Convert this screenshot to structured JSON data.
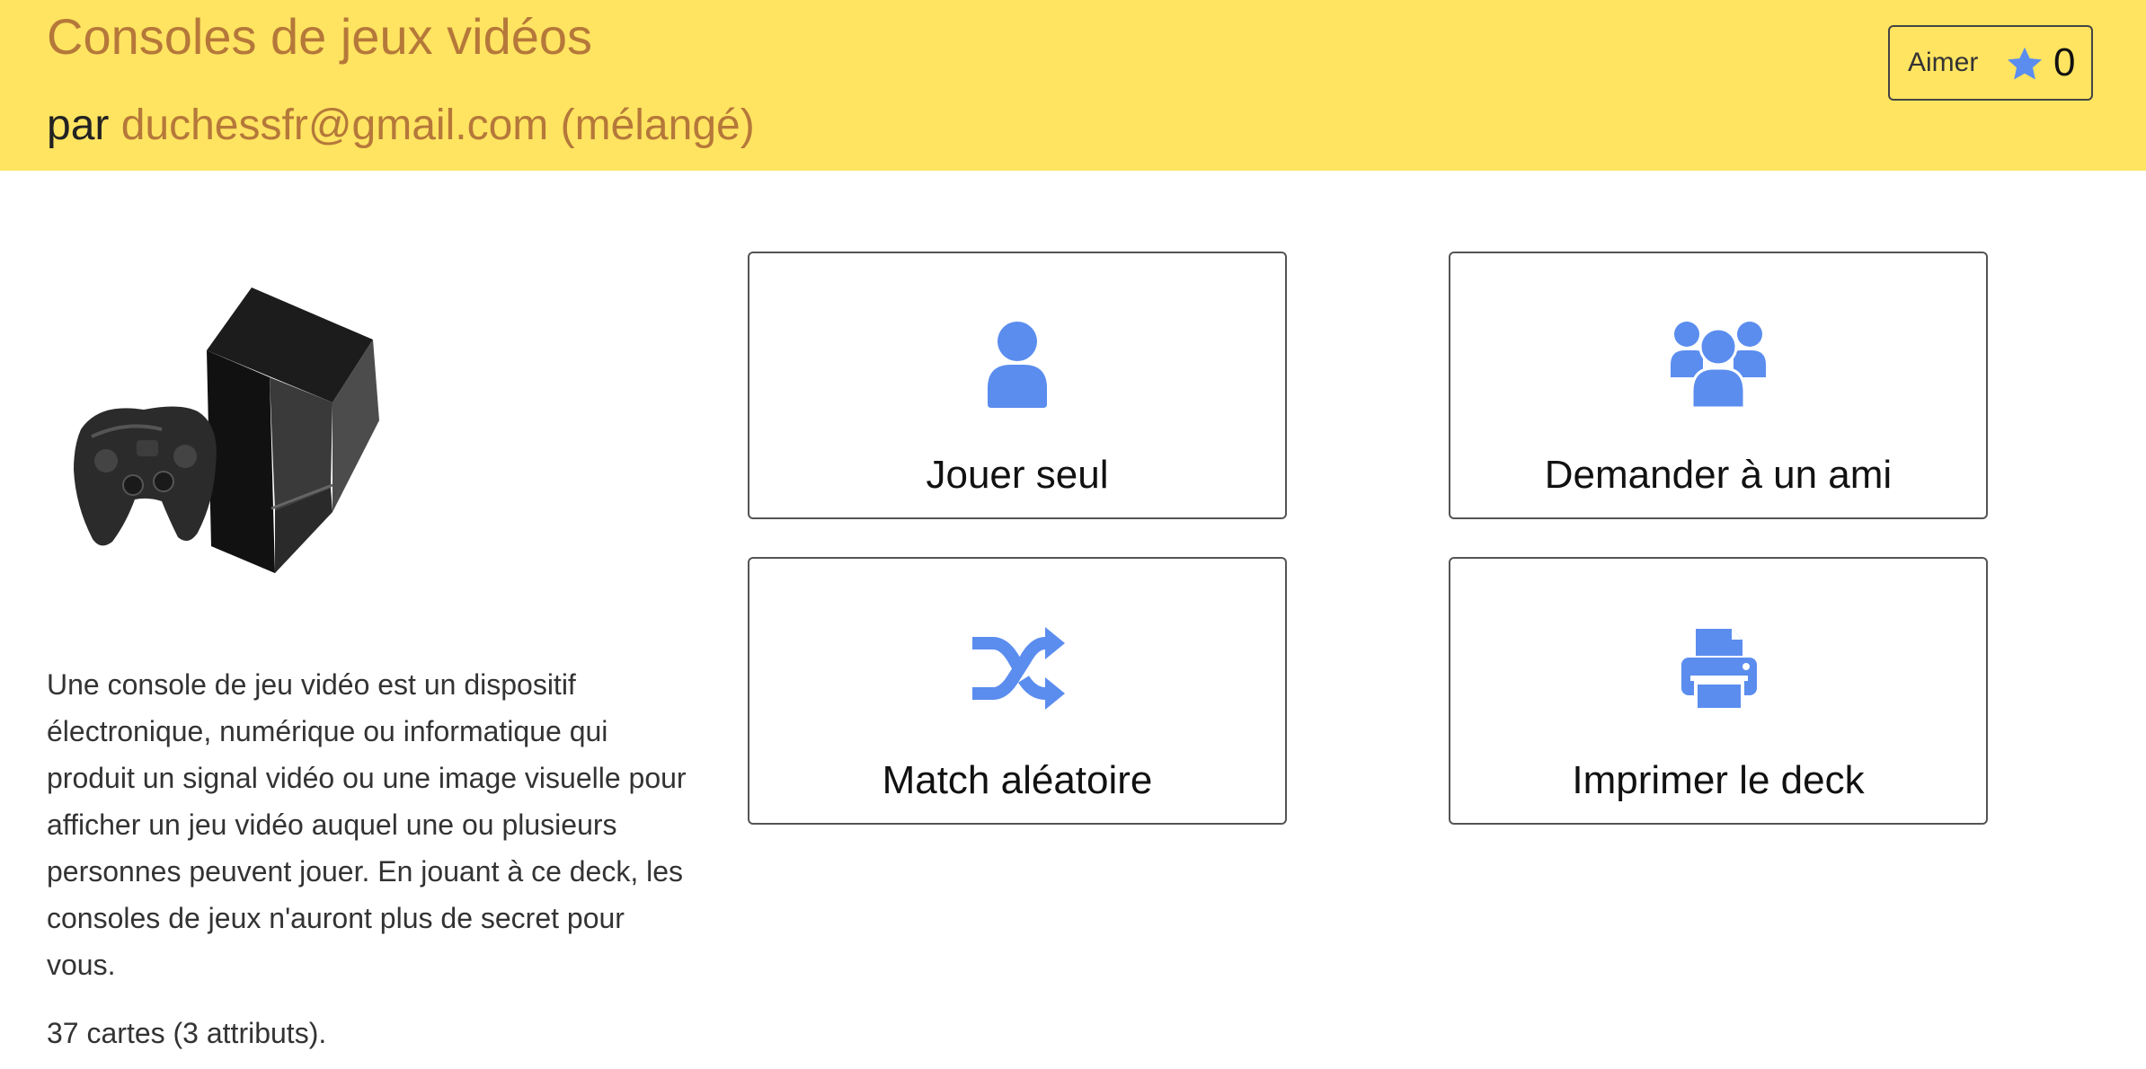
{
  "header": {
    "title": "Consoles de jeux vidéos",
    "by_prefix": "par",
    "author": "duchessfr@gmail.com (mélangé)",
    "background_color": "#ffe461",
    "title_color": "#b5783a"
  },
  "like": {
    "label": "Aimer",
    "icon": "star-icon",
    "count": "0",
    "icon_color": "#5b8def"
  },
  "deck": {
    "image": "game-console-image",
    "description": "Une console de jeu vidéo est un dispositif électronique, numérique ou informatique qui produit un signal vidéo ou une image visuelle pour afficher un jeu vidéo auquel une ou plusieurs personnes peuvent jouer. En jouant à ce deck, les consoles de jeux n'auront plus de secret pour vous.",
    "card_count": "37 cartes (3 attributs)."
  },
  "actions": [
    {
      "label": "Jouer seul",
      "icon": "user-icon"
    },
    {
      "label": "Demander à un ami",
      "icon": "users-icon"
    },
    {
      "label": "Match aléatoire",
      "icon": "shuffle-icon"
    },
    {
      "label": "Imprimer le deck",
      "icon": "print-icon"
    }
  ],
  "colors": {
    "icon_blue": "#5b8def"
  }
}
